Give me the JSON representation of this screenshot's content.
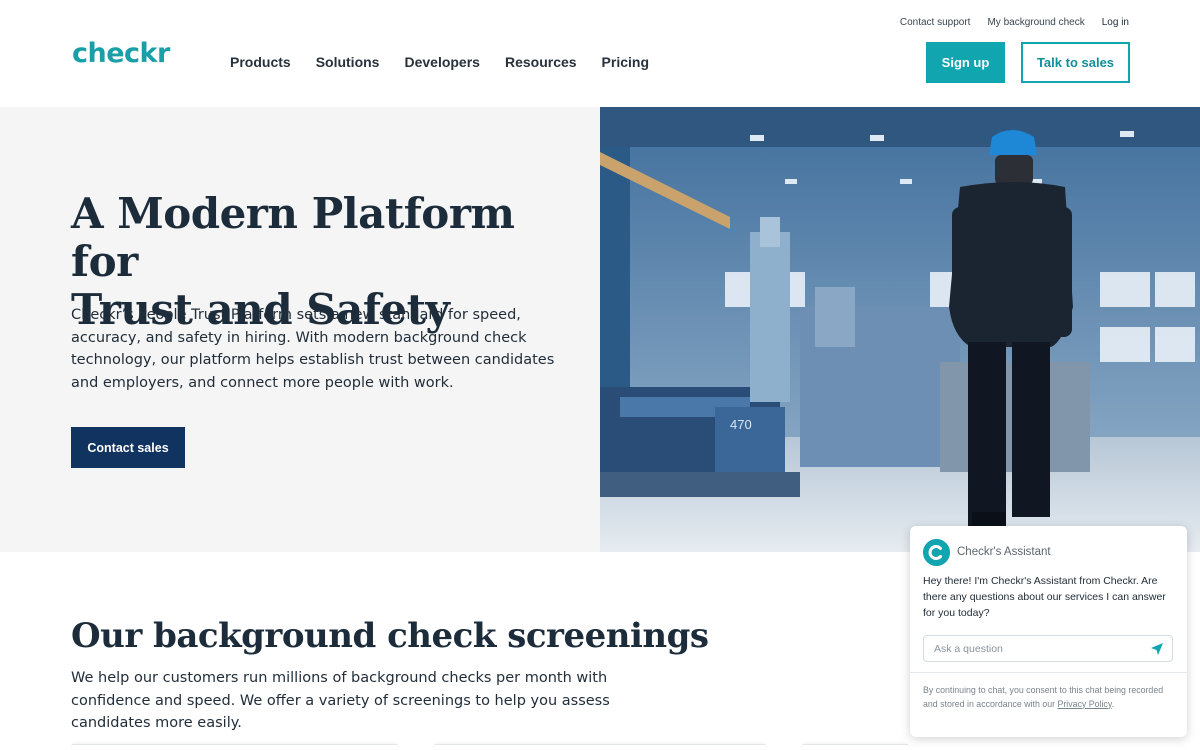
{
  "header": {
    "logo": "checkr",
    "util_links": [
      "Contact support",
      "My background check",
      "Log in"
    ],
    "nav": [
      "Products",
      "Solutions",
      "Developers",
      "Resources",
      "Pricing"
    ],
    "signup_label": "Sign up",
    "talk_label": "Talk to sales"
  },
  "hero": {
    "title_line1": "A Modern Platform for",
    "title_line2": "Trust and Safety",
    "description": "Checkr’s People Trust Platform sets a new standard for speed, accuracy, and safety in hiring. With modern background check technology, our platform helps establish trust between candidates and employers, and connect more people with work.",
    "cta_label": "Contact sales",
    "image_label": "470"
  },
  "screenings": {
    "title": "Our background check screenings",
    "description": "We help our customers run millions of background checks per month with confidence and speed. We offer a variety of screenings to help you assess candidates more easily."
  },
  "chat": {
    "assistant_name": "Checkr's Assistant",
    "message": "Hey there! I'm Checkr's Assistant from Checkr. Are there any questions about our services I can answer for you today?",
    "input_placeholder": "Ask a question",
    "footer_text": "By continuing to chat, you consent to this chat being recorded and stored in accordance with our ",
    "footer_link": "Privacy Policy",
    "footer_end": "."
  },
  "colors": {
    "brand_teal": "#11a5b0",
    "navy": "#10335f",
    "hero_bg": "#f5f5f5"
  }
}
